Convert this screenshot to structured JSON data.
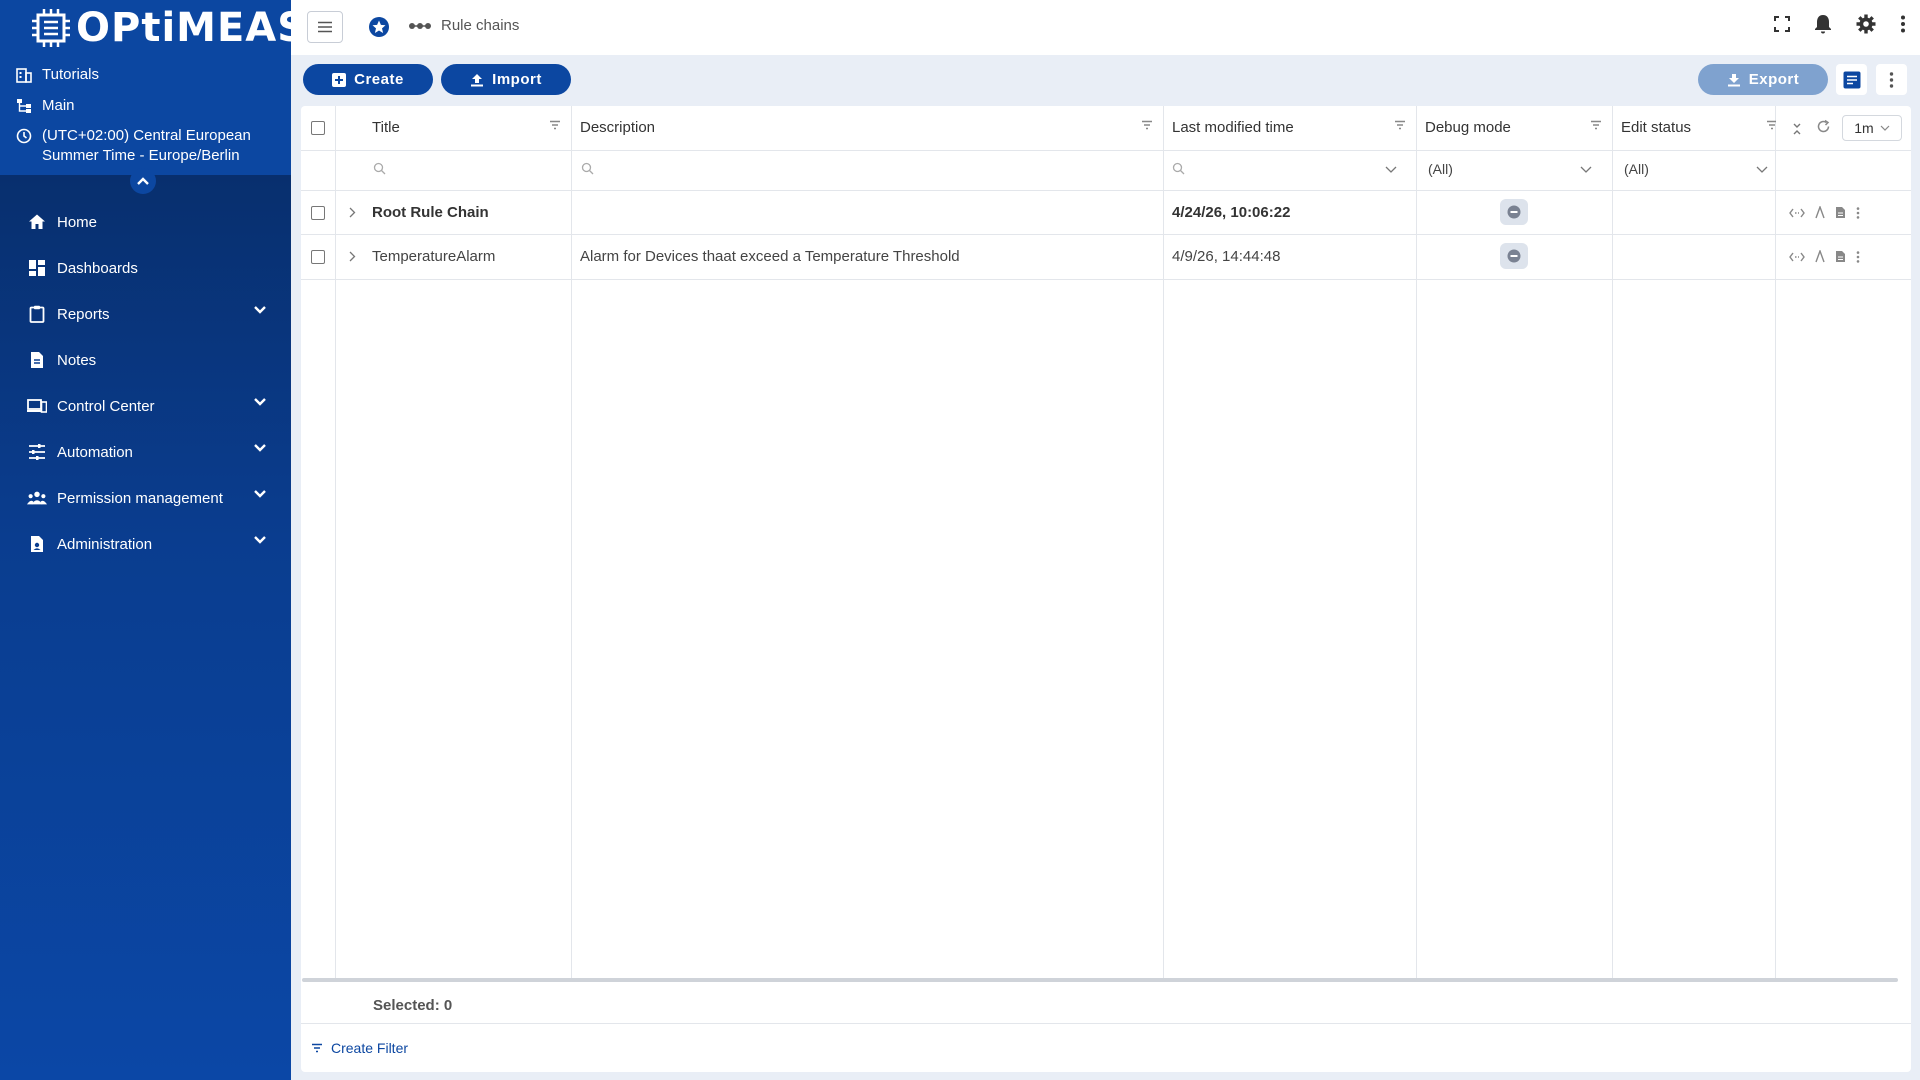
{
  "brand": {
    "logo_text": "OPtiMEAS"
  },
  "sidebar": {
    "tutorials": "Tutorials",
    "main": "Main",
    "timezone": "(UTC+02:00) Central European Summer Time - Europe/Berlin",
    "items": [
      {
        "label": "Home",
        "icon": "home-icon",
        "expandable": false
      },
      {
        "label": "Dashboards",
        "icon": "dashboards-icon",
        "expandable": false
      },
      {
        "label": "Reports",
        "icon": "clipboard-icon",
        "expandable": true
      },
      {
        "label": "Notes",
        "icon": "note-icon",
        "expandable": false
      },
      {
        "label": "Control Center",
        "icon": "devices-icon",
        "expandable": true
      },
      {
        "label": "Automation",
        "icon": "tune-icon",
        "expandable": true
      },
      {
        "label": "Permission management",
        "icon": "people-icon",
        "expandable": true
      },
      {
        "label": "Administration",
        "icon": "admin-icon",
        "expandable": true
      }
    ]
  },
  "header": {
    "breadcrumb": "Rule chains"
  },
  "toolbar": {
    "create": "Create",
    "import": "Import",
    "export": "Export"
  },
  "table": {
    "columns": [
      "Title",
      "Description",
      "Last modified time",
      "Debug mode",
      "Edit status"
    ],
    "filters": {
      "debug_mode": "(All)",
      "edit_status": "(All)"
    },
    "refresh_interval": "1m",
    "rows": [
      {
        "title": "Root Rule Chain",
        "description": "",
        "modified": "4/24/26, 10:06:22",
        "bold": true
      },
      {
        "title": "TemperatureAlarm",
        "description": "Alarm for Devices thaat exceed a Temperature Threshold",
        "modified": "4/9/26, 14:44:48",
        "bold": false
      }
    ],
    "selected": "Selected: 0",
    "create_filter": "Create Filter"
  },
  "colors": {
    "primary": "#0c47a1",
    "sidebar": "#0a3a8a",
    "export_disabled": "#7fa2cf"
  }
}
